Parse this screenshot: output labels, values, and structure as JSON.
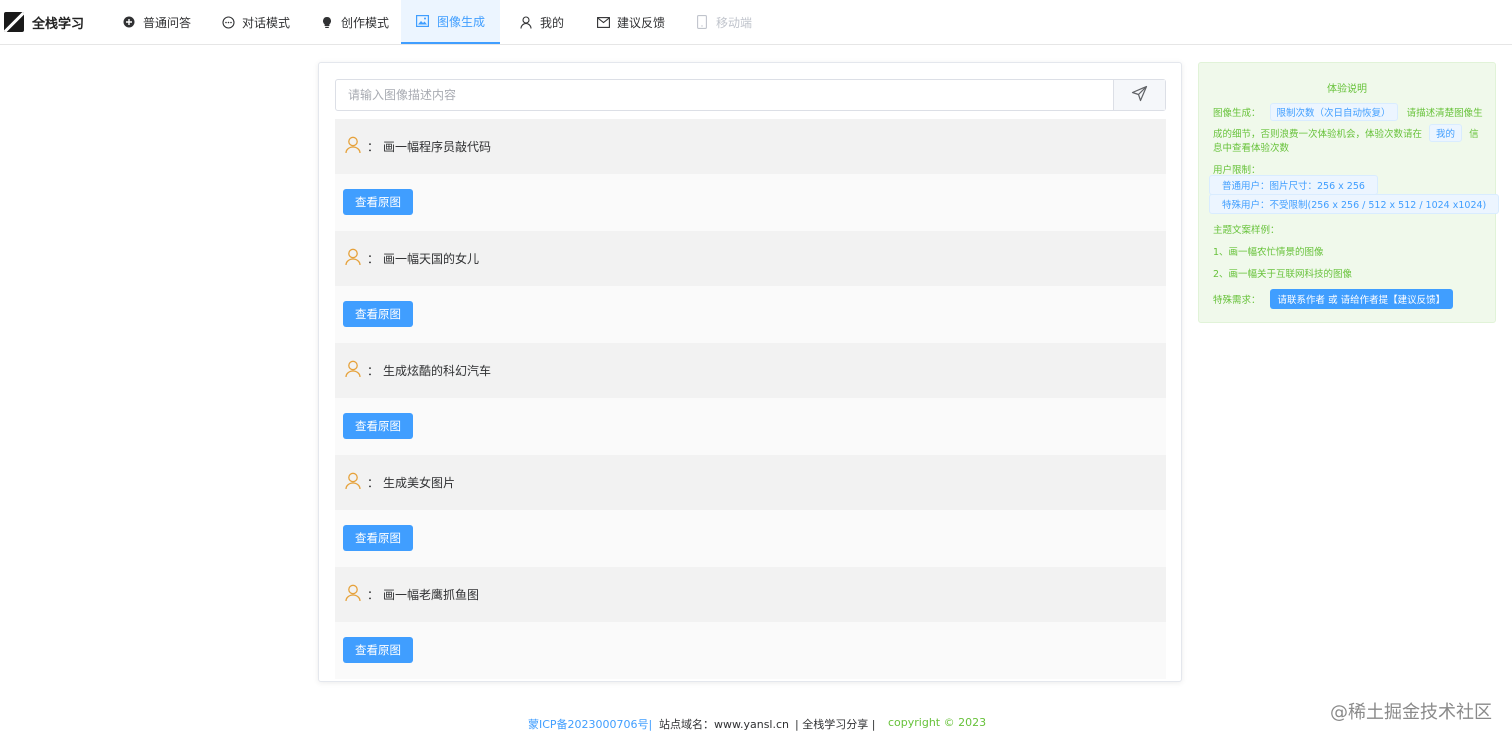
{
  "nav": {
    "brand": "全栈学习",
    "items": [
      {
        "label": "普通问答"
      },
      {
        "label": "对话模式"
      },
      {
        "label": "创作模式"
      },
      {
        "label": "图像生成"
      },
      {
        "label": "我的"
      },
      {
        "label": "建议反馈"
      },
      {
        "label": "移动端"
      }
    ],
    "active_index": 3
  },
  "search": {
    "placeholder": "请输入图像描述内容"
  },
  "items": [
    {
      "prompt": "画一幅程序员敲代码",
      "button": "查看原图"
    },
    {
      "prompt": "画一幅天国的女儿",
      "button": "查看原图"
    },
    {
      "prompt": "生成炫酷的科幻汽车",
      "button": "查看原图"
    },
    {
      "prompt": "生成美女图片",
      "button": "查看原图"
    },
    {
      "prompt": "画一幅老鹰抓鱼图",
      "button": "查看原图"
    }
  ],
  "prompt_prefix": "：",
  "side": {
    "title": "体验说明",
    "gen_label": "图像生成：",
    "gen_tag": "限制次数（次日自动恢复）",
    "gen_text1": "请描述清楚图像生",
    "gen_text2": "成的细节，否则浪费一次体验机会，体验次数请在",
    "gen_tag2": "我的",
    "gen_text3": "信",
    "gen_text4": "息中查看体验次数",
    "user_limit_label": "用户限制：",
    "user_normal": "普通用户：图片尺寸：256 x 256",
    "user_special": "特殊用户：不受限制(256 x 256 / 512 x 512 / 1024 x1024)",
    "examples_label": "主题文案样例：",
    "example1": "1、画一幅农忙情景的图像",
    "example2": "2、画一幅关于互联网科技的图像",
    "special_label": "特殊需求：",
    "special_button": "请联系作者 或 请给作者提【建议反馈】"
  },
  "footer": {
    "icp": "蒙ICP备2023000706号|",
    "domain": "站点域名：www.yansl.cn",
    "share": "| 全栈学习分享 |",
    "copyright": "copyright © 2023"
  },
  "watermark": "@稀土掘金技术社区",
  "colors": {
    "primary": "#409eff",
    "success": "#67c23a",
    "avatar": "#e6a23c"
  }
}
